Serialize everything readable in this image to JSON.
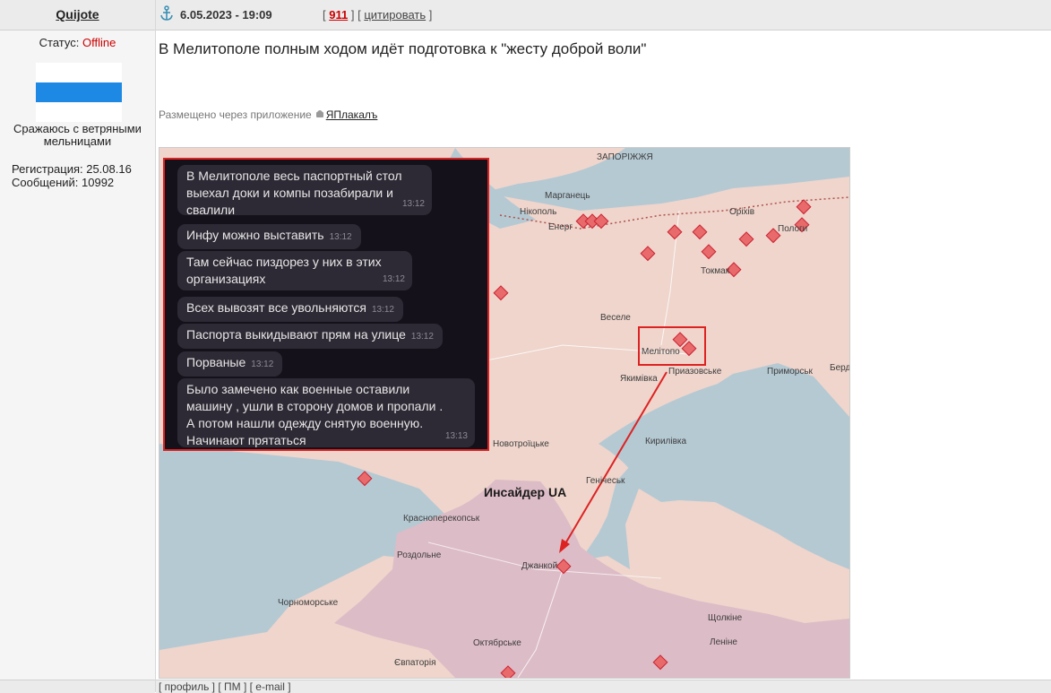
{
  "user": {
    "username": "Quijote",
    "status_label": "Статус:",
    "status_value": "Offline",
    "title_line1": "Сражаюсь с ветряными",
    "title_line2": "мельницами",
    "registration": "Регистрация: 25.08.16",
    "messages": "Сообщений: 10992"
  },
  "post": {
    "date": "6.05.2023 - 19:09",
    "bracket_open": "[",
    "number": "911",
    "quote_bracket": "] [",
    "quote_label": "цитировать",
    "bracket_close": "]",
    "title": "В Мелитополе полным ходом идёт подготовка к \"жесту доброй воли\"",
    "via_text": "Размещено через приложение",
    "app_name": "ЯПлакалъ"
  },
  "chat": {
    "messages": [
      {
        "text1": "В Мелитополе  весь паспортный стол",
        "text2": "выехал доки и компы позабирали и",
        "text3": "свалили",
        "time": "13:12"
      },
      {
        "text1": "Инфу можно выставить",
        "time": "13:12"
      },
      {
        "text1": "Там сейчас пиздорез у них в этих",
        "text2": "организациях",
        "time": "13:12"
      },
      {
        "text1": "Всех вывозят все увольняются",
        "time": "13:12"
      },
      {
        "text1": "Паспорта выкидывают прям на улице",
        "time": "13:12"
      },
      {
        "text1": "Порваные",
        "time": "13:12"
      },
      {
        "text1": "Было замечено как военные оставили",
        "text2": "машину , ушли в сторону домов и пропали .",
        "text3": "А потом нашли одежду снятую военную.",
        "text4": "Начинают прятаться",
        "time": "13:13"
      }
    ]
  },
  "map": {
    "labels": {
      "zaporizhzhia": "ЗАПОРІЖЖЯ",
      "marhanets": "Марганець",
      "nikopol": "Нікополь",
      "enerhodar": "Енерг",
      "orikhiv": "Оріхів",
      "polohy": "Пологи",
      "tokmak": "Токмак",
      "vesele": "Веселе",
      "melitopol": "Мелітопо",
      "yakymivka": "Якимівка",
      "pryazovske": "Приазовське",
      "prymorsk": "Приморськ",
      "berdiansk": "Берд",
      "kyrylivka": "Кирилівка",
      "novotroitske": "Новотроїцьке",
      "henichesk": "Генічеськ",
      "insider": "Инсайдер UA",
      "krasnoperekopsk": "Красноперекопськ",
      "rozdolne": "Роздольне",
      "dzhankoi": "Джанкой",
      "chornomorske": "Чорноморське",
      "oktiabrske": "Октябрське",
      "yevpatoria": "Євпаторія",
      "shcholkine": "Щолкіне",
      "lenine": "Леніне"
    }
  },
  "footer": {
    "links": "[ профиль ] [ ПМ ] [ e-mail ]"
  },
  "colors": {
    "header_bg": "#ebebeb",
    "accent_red": "#cc0000",
    "map_land": "#efd5cc",
    "map_water": "#b5c9d3"
  }
}
